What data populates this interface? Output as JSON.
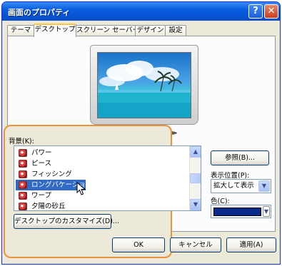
{
  "window": {
    "title": "画面のプロパティ",
    "help_label": "?",
    "close_label": "✕"
  },
  "tabs": [
    {
      "label": "テーマ"
    },
    {
      "label": "デスクトップ"
    },
    {
      "label": "スクリーン セーバー"
    },
    {
      "label": "デザイン"
    },
    {
      "label": "設定"
    }
  ],
  "active_tab": "デスクトップ",
  "background": {
    "label": "背景(K):",
    "items": [
      {
        "label": "パワー",
        "icon": "wallpaper-icon"
      },
      {
        "label": "ピース",
        "icon": "wallpaper-icon"
      },
      {
        "label": "フィッシング",
        "icon": "wallpaper-icon"
      },
      {
        "label": "ロングバケーション",
        "icon": "wallpaper-icon",
        "selected": true
      },
      {
        "label": "ワープ",
        "icon": "wallpaper-icon"
      },
      {
        "label": "夕陽の砂丘",
        "icon": "wallpaper-icon"
      }
    ]
  },
  "customize_button": "デスクトップのカスタマイズ(D)...",
  "browse_button": "参照(B)...",
  "position": {
    "label": "表示位置(P):",
    "value": "拡大して表示"
  },
  "color": {
    "label": "色(C):",
    "value": "#0a2a8a"
  },
  "bottom_buttons": {
    "ok": "OK",
    "cancel": "キャンセル",
    "apply": "適用(A)"
  },
  "colors": {
    "highlight_border": "#e8923c",
    "selection": "#316ac5",
    "title_bar": "#0654d6"
  }
}
